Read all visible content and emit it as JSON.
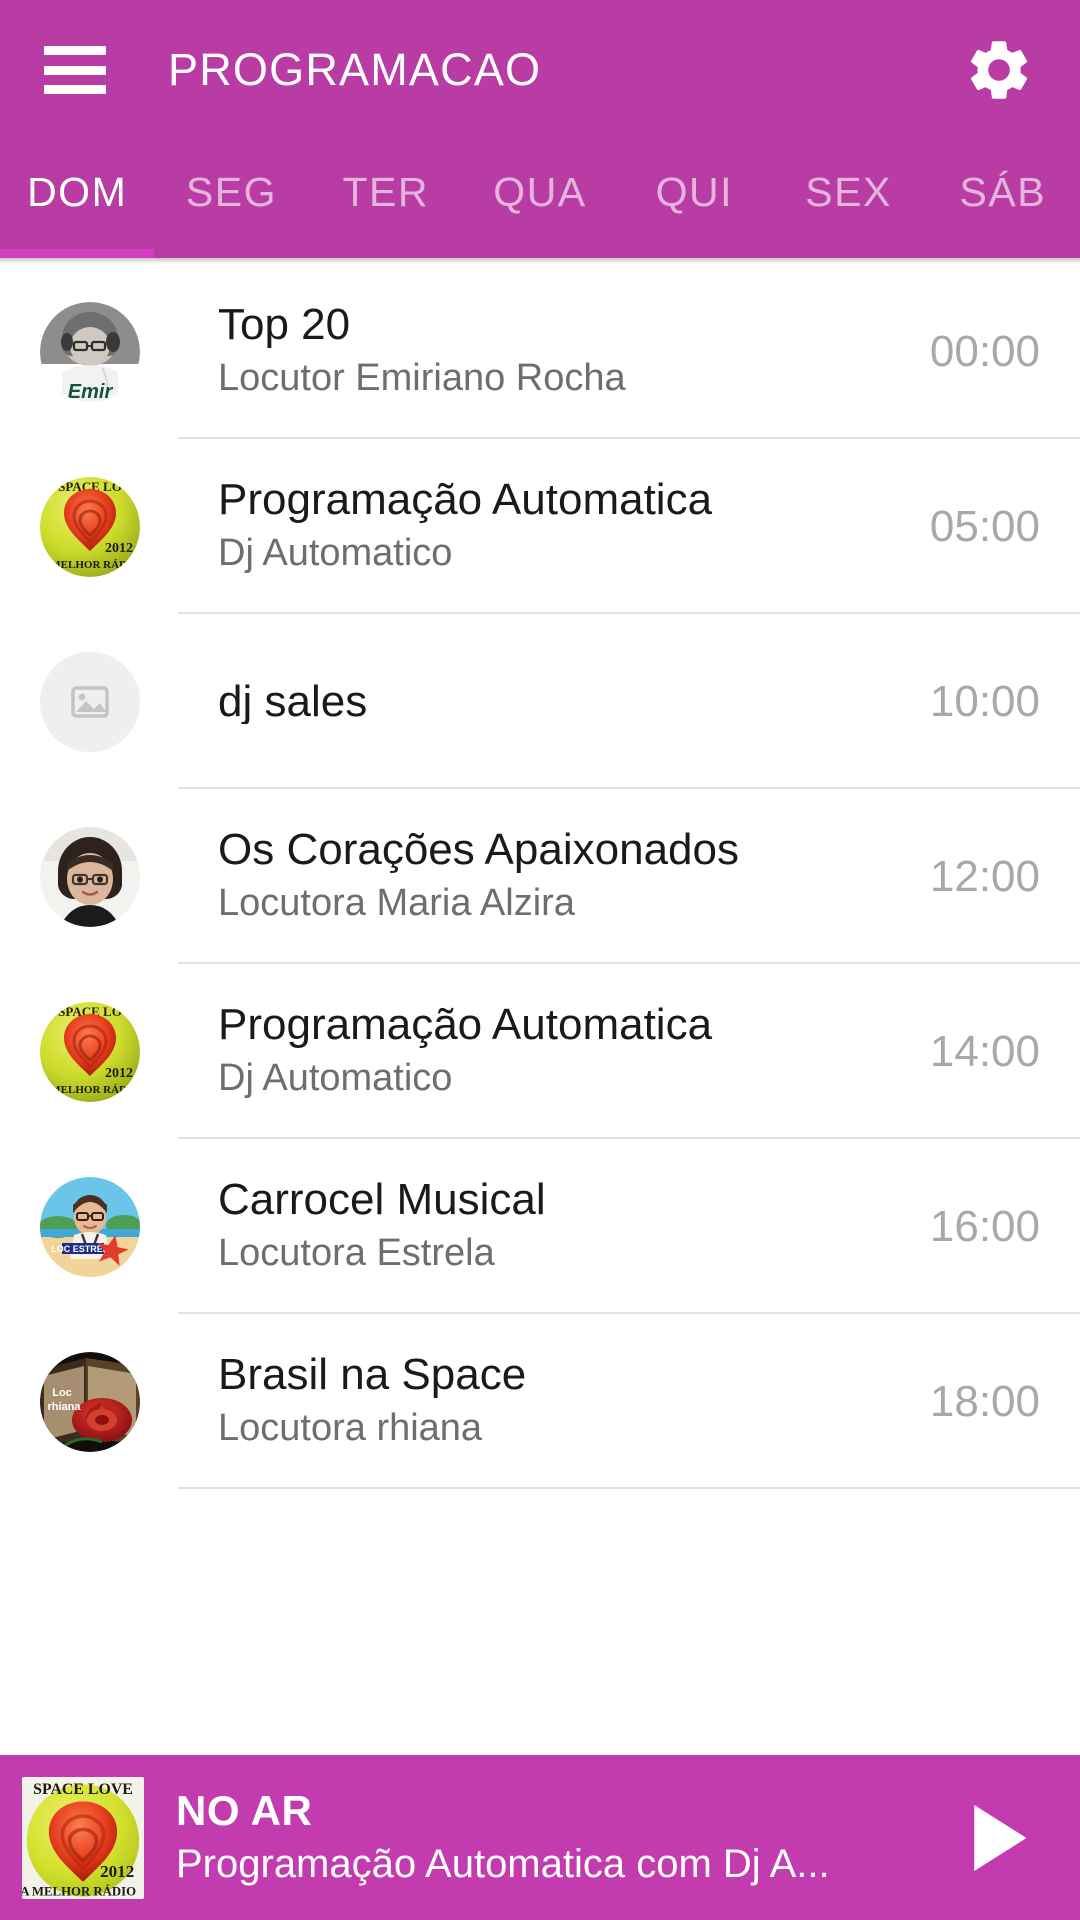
{
  "appbar": {
    "menu_icon": "hamburger-menu-icon",
    "title": "PROGRAMACAO",
    "settings_icon": "gear-icon",
    "background_color": "#b93ca5"
  },
  "tabs": {
    "active_index": 0,
    "indicator_color": "#d13ec0",
    "items": [
      {
        "label": "DOM"
      },
      {
        "label": "SEG"
      },
      {
        "label": "TER"
      },
      {
        "label": "QUA"
      },
      {
        "label": "QUI"
      },
      {
        "label": "SEX"
      },
      {
        "label": "SÁB"
      }
    ]
  },
  "schedule": {
    "rows": [
      {
        "title": "Top 20",
        "subtitle": "Locutor Emiriano Rocha",
        "time": "00:00",
        "avatar": "photo-emir"
      },
      {
        "title": "Programação Automatica",
        "subtitle": "Dj Automatico",
        "time": "05:00",
        "avatar": "logo-space-love"
      },
      {
        "title": "dj sales",
        "subtitle": "",
        "time": "10:00",
        "avatar": "image-placeholder-icon"
      },
      {
        "title": "Os Corações Apaixonados",
        "subtitle": "Locutora Maria Alzira",
        "time": "12:00",
        "avatar": "photo-maria-alzira"
      },
      {
        "title": "Programação Automatica",
        "subtitle": "Dj Automatico",
        "time": "14:00",
        "avatar": "logo-space-love"
      },
      {
        "title": "Carrocel Musical",
        "subtitle": "Locutora Estrela",
        "time": "16:00",
        "avatar": "photo-loc-estrela"
      },
      {
        "title": "Brasil na Space",
        "subtitle": "Locutora rhiana",
        "time": "18:00",
        "avatar": "photo-loc-rhiana"
      }
    ]
  },
  "player": {
    "status_label": "NO AR",
    "now_playing": "Programação Automatica com Dj A...",
    "play_icon": "play-icon",
    "artwork": "logo-space-love",
    "background_color": "#c23cb0",
    "artwork_text_top": "SPACE LOVE",
    "artwork_text_year": "2012",
    "artwork_text_bottom": "A MELHOR RÁDIO"
  }
}
